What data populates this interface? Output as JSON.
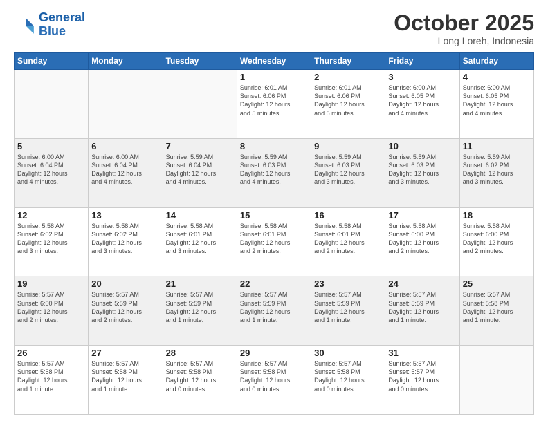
{
  "header": {
    "logo_line1": "General",
    "logo_line2": "Blue",
    "month": "October 2025",
    "location": "Long Loreh, Indonesia"
  },
  "weekdays": [
    "Sunday",
    "Monday",
    "Tuesday",
    "Wednesday",
    "Thursday",
    "Friday",
    "Saturday"
  ],
  "weeks": [
    [
      {
        "day": "",
        "info": "",
        "empty": true
      },
      {
        "day": "",
        "info": "",
        "empty": true
      },
      {
        "day": "",
        "info": "",
        "empty": true
      },
      {
        "day": "1",
        "info": "Sunrise: 6:01 AM\nSunset: 6:06 PM\nDaylight: 12 hours\nand 5 minutes.",
        "empty": false
      },
      {
        "day": "2",
        "info": "Sunrise: 6:01 AM\nSunset: 6:06 PM\nDaylight: 12 hours\nand 5 minutes.",
        "empty": false
      },
      {
        "day": "3",
        "info": "Sunrise: 6:00 AM\nSunset: 6:05 PM\nDaylight: 12 hours\nand 4 minutes.",
        "empty": false
      },
      {
        "day": "4",
        "info": "Sunrise: 6:00 AM\nSunset: 6:05 PM\nDaylight: 12 hours\nand 4 minutes.",
        "empty": false
      }
    ],
    [
      {
        "day": "5",
        "info": "Sunrise: 6:00 AM\nSunset: 6:04 PM\nDaylight: 12 hours\nand 4 minutes.",
        "empty": false
      },
      {
        "day": "6",
        "info": "Sunrise: 6:00 AM\nSunset: 6:04 PM\nDaylight: 12 hours\nand 4 minutes.",
        "empty": false
      },
      {
        "day": "7",
        "info": "Sunrise: 5:59 AM\nSunset: 6:04 PM\nDaylight: 12 hours\nand 4 minutes.",
        "empty": false
      },
      {
        "day": "8",
        "info": "Sunrise: 5:59 AM\nSunset: 6:03 PM\nDaylight: 12 hours\nand 4 minutes.",
        "empty": false
      },
      {
        "day": "9",
        "info": "Sunrise: 5:59 AM\nSunset: 6:03 PM\nDaylight: 12 hours\nand 3 minutes.",
        "empty": false
      },
      {
        "day": "10",
        "info": "Sunrise: 5:59 AM\nSunset: 6:03 PM\nDaylight: 12 hours\nand 3 minutes.",
        "empty": false
      },
      {
        "day": "11",
        "info": "Sunrise: 5:59 AM\nSunset: 6:02 PM\nDaylight: 12 hours\nand 3 minutes.",
        "empty": false
      }
    ],
    [
      {
        "day": "12",
        "info": "Sunrise: 5:58 AM\nSunset: 6:02 PM\nDaylight: 12 hours\nand 3 minutes.",
        "empty": false
      },
      {
        "day": "13",
        "info": "Sunrise: 5:58 AM\nSunset: 6:02 PM\nDaylight: 12 hours\nand 3 minutes.",
        "empty": false
      },
      {
        "day": "14",
        "info": "Sunrise: 5:58 AM\nSunset: 6:01 PM\nDaylight: 12 hours\nand 3 minutes.",
        "empty": false
      },
      {
        "day": "15",
        "info": "Sunrise: 5:58 AM\nSunset: 6:01 PM\nDaylight: 12 hours\nand 2 minutes.",
        "empty": false
      },
      {
        "day": "16",
        "info": "Sunrise: 5:58 AM\nSunset: 6:01 PM\nDaylight: 12 hours\nand 2 minutes.",
        "empty": false
      },
      {
        "day": "17",
        "info": "Sunrise: 5:58 AM\nSunset: 6:00 PM\nDaylight: 12 hours\nand 2 minutes.",
        "empty": false
      },
      {
        "day": "18",
        "info": "Sunrise: 5:58 AM\nSunset: 6:00 PM\nDaylight: 12 hours\nand 2 minutes.",
        "empty": false
      }
    ],
    [
      {
        "day": "19",
        "info": "Sunrise: 5:57 AM\nSunset: 6:00 PM\nDaylight: 12 hours\nand 2 minutes.",
        "empty": false
      },
      {
        "day": "20",
        "info": "Sunrise: 5:57 AM\nSunset: 5:59 PM\nDaylight: 12 hours\nand 2 minutes.",
        "empty": false
      },
      {
        "day": "21",
        "info": "Sunrise: 5:57 AM\nSunset: 5:59 PM\nDaylight: 12 hours\nand 1 minute.",
        "empty": false
      },
      {
        "day": "22",
        "info": "Sunrise: 5:57 AM\nSunset: 5:59 PM\nDaylight: 12 hours\nand 1 minute.",
        "empty": false
      },
      {
        "day": "23",
        "info": "Sunrise: 5:57 AM\nSunset: 5:59 PM\nDaylight: 12 hours\nand 1 minute.",
        "empty": false
      },
      {
        "day": "24",
        "info": "Sunrise: 5:57 AM\nSunset: 5:59 PM\nDaylight: 12 hours\nand 1 minute.",
        "empty": false
      },
      {
        "day": "25",
        "info": "Sunrise: 5:57 AM\nSunset: 5:58 PM\nDaylight: 12 hours\nand 1 minute.",
        "empty": false
      }
    ],
    [
      {
        "day": "26",
        "info": "Sunrise: 5:57 AM\nSunset: 5:58 PM\nDaylight: 12 hours\nand 1 minute.",
        "empty": false
      },
      {
        "day": "27",
        "info": "Sunrise: 5:57 AM\nSunset: 5:58 PM\nDaylight: 12 hours\nand 1 minute.",
        "empty": false
      },
      {
        "day": "28",
        "info": "Sunrise: 5:57 AM\nSunset: 5:58 PM\nDaylight: 12 hours\nand 0 minutes.",
        "empty": false
      },
      {
        "day": "29",
        "info": "Sunrise: 5:57 AM\nSunset: 5:58 PM\nDaylight: 12 hours\nand 0 minutes.",
        "empty": false
      },
      {
        "day": "30",
        "info": "Sunrise: 5:57 AM\nSunset: 5:58 PM\nDaylight: 12 hours\nand 0 minutes.",
        "empty": false
      },
      {
        "day": "31",
        "info": "Sunrise: 5:57 AM\nSunset: 5:57 PM\nDaylight: 12 hours\nand 0 minutes.",
        "empty": false
      },
      {
        "day": "",
        "info": "",
        "empty": true
      }
    ]
  ]
}
